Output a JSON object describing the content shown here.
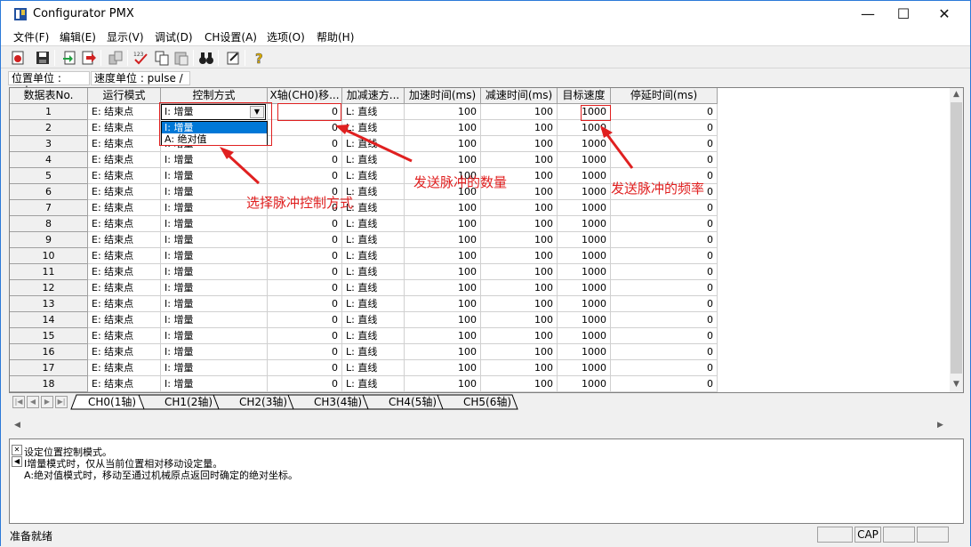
{
  "window": {
    "title": "Configurator PMX",
    "minimize": "—",
    "maximize": "☐",
    "close": "✕"
  },
  "menu": [
    "文件(F)",
    "编辑(E)",
    "显示(V)",
    "调试(D)",
    "CH设置(A)",
    "选项(O)",
    "帮助(H)"
  ],
  "units": {
    "position": "位置单位 : pulse",
    "speed": "速度单位 : pulse / s"
  },
  "columns": [
    "数据表No.",
    "运行模式",
    "控制方式",
    "X轴(CH0)移...",
    "加减速方...",
    "加速时间(ms)",
    "减速时间(ms)",
    "目标速度",
    "停延时间(ms)"
  ],
  "rows": [
    {
      "no": "1",
      "mode": "E: 结束点",
      "ctrl": "I: 增量",
      "move": "0",
      "accel_mode": "L: 直线",
      "acc": "100",
      "dec": "100",
      "speed": "1000",
      "dwell": "0"
    },
    {
      "no": "2",
      "mode": "E: 结束点",
      "ctrl": "I: 增量",
      "move": "0",
      "accel_mode": "L: 直线",
      "acc": "100",
      "dec": "100",
      "speed": "1000",
      "dwell": "0"
    },
    {
      "no": "3",
      "mode": "E: 结束点",
      "ctrl": "I: 增量",
      "move": "0",
      "accel_mode": "L: 直线",
      "acc": "100",
      "dec": "100",
      "speed": "1000",
      "dwell": "0"
    },
    {
      "no": "4",
      "mode": "E: 结束点",
      "ctrl": "I: 增量",
      "move": "0",
      "accel_mode": "L: 直线",
      "acc": "100",
      "dec": "100",
      "speed": "1000",
      "dwell": "0"
    },
    {
      "no": "5",
      "mode": "E: 结束点",
      "ctrl": "I: 增量",
      "move": "0",
      "accel_mode": "L: 直线",
      "acc": "100",
      "dec": "100",
      "speed": "1000",
      "dwell": "0"
    },
    {
      "no": "6",
      "mode": "E: 结束点",
      "ctrl": "I: 增量",
      "move": "0",
      "accel_mode": "L: 直线",
      "acc": "100",
      "dec": "100",
      "speed": "1000",
      "dwell": "0"
    },
    {
      "no": "7",
      "mode": "E: 结束点",
      "ctrl": "I: 增量",
      "move": "0",
      "accel_mode": "L: 直线",
      "acc": "100",
      "dec": "100",
      "speed": "1000",
      "dwell": "0"
    },
    {
      "no": "8",
      "mode": "E: 结束点",
      "ctrl": "I: 增量",
      "move": "0",
      "accel_mode": "L: 直线",
      "acc": "100",
      "dec": "100",
      "speed": "1000",
      "dwell": "0"
    },
    {
      "no": "9",
      "mode": "E: 结束点",
      "ctrl": "I: 增量",
      "move": "0",
      "accel_mode": "L: 直线",
      "acc": "100",
      "dec": "100",
      "speed": "1000",
      "dwell": "0"
    },
    {
      "no": "10",
      "mode": "E: 结束点",
      "ctrl": "I: 增量",
      "move": "0",
      "accel_mode": "L: 直线",
      "acc": "100",
      "dec": "100",
      "speed": "1000",
      "dwell": "0"
    },
    {
      "no": "11",
      "mode": "E: 结束点",
      "ctrl": "I: 增量",
      "move": "0",
      "accel_mode": "L: 直线",
      "acc": "100",
      "dec": "100",
      "speed": "1000",
      "dwell": "0"
    },
    {
      "no": "12",
      "mode": "E: 结束点",
      "ctrl": "I: 增量",
      "move": "0",
      "accel_mode": "L: 直线",
      "acc": "100",
      "dec": "100",
      "speed": "1000",
      "dwell": "0"
    },
    {
      "no": "13",
      "mode": "E: 结束点",
      "ctrl": "I: 增量",
      "move": "0",
      "accel_mode": "L: 直线",
      "acc": "100",
      "dec": "100",
      "speed": "1000",
      "dwell": "0"
    },
    {
      "no": "14",
      "mode": "E: 结束点",
      "ctrl": "I: 增量",
      "move": "0",
      "accel_mode": "L: 直线",
      "acc": "100",
      "dec": "100",
      "speed": "1000",
      "dwell": "0"
    },
    {
      "no": "15",
      "mode": "E: 结束点",
      "ctrl": "I: 增量",
      "move": "0",
      "accel_mode": "L: 直线",
      "acc": "100",
      "dec": "100",
      "speed": "1000",
      "dwell": "0"
    },
    {
      "no": "16",
      "mode": "E: 结束点",
      "ctrl": "I: 增量",
      "move": "0",
      "accel_mode": "L: 直线",
      "acc": "100",
      "dec": "100",
      "speed": "1000",
      "dwell": "0"
    },
    {
      "no": "17",
      "mode": "E: 结束点",
      "ctrl": "I: 增量",
      "move": "0",
      "accel_mode": "L: 直线",
      "acc": "100",
      "dec": "100",
      "speed": "1000",
      "dwell": "0"
    },
    {
      "no": "18",
      "mode": "E: 结束点",
      "ctrl": "I: 增量",
      "move": "0",
      "accel_mode": "L: 直线",
      "acc": "100",
      "dec": "100",
      "speed": "1000",
      "dwell": "0"
    }
  ],
  "dropdown": {
    "selected": "I: 增量",
    "options": [
      "I: 增量",
      "A: 绝对值"
    ]
  },
  "tabs": [
    "CH0(1轴)",
    "CH1(2轴)",
    "CH2(3轴)",
    "CH3(4轴)",
    "CH4(5轴)",
    "CH5(6轴)"
  ],
  "active_tab": 0,
  "messages": [
    "设定位置控制模式。",
    "I增量模式时，仅从当前位置相对移动设定量。",
    "A:绝对值模式时，移动至通过机械原点返回时确定的绝对坐标。"
  ],
  "status": {
    "text": "准备就绪",
    "cap": "CAP"
  },
  "annotations": {
    "ctrl": "选择脉冲控制方式",
    "pulses": "发送脉冲的数量",
    "freq": "发送脉冲的频率"
  },
  "colors": {
    "accent": "#0078d7",
    "annotation": "#e02020"
  }
}
